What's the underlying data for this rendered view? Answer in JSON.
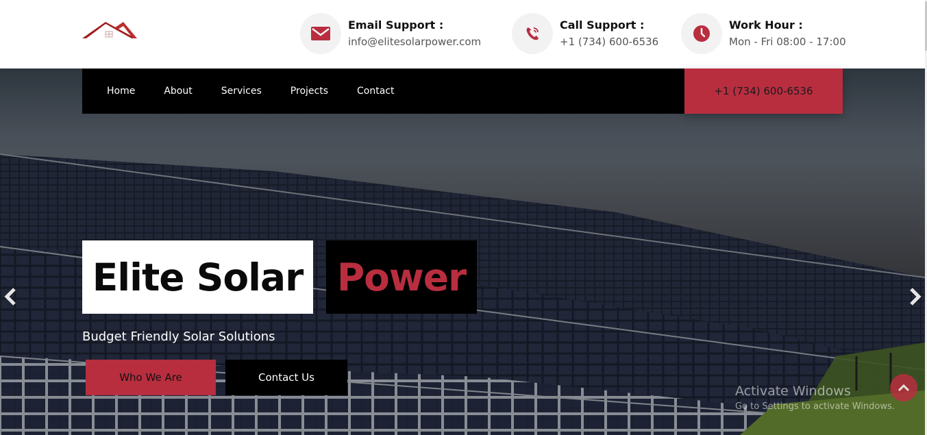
{
  "header": {
    "email_label": "Email Support :",
    "email_value": "info@elitesolarpower.com",
    "call_label": "Call Support :",
    "call_value": "+1 (734) 600-6536",
    "hour_label": "Work Hour :",
    "hour_value": "Mon - Fri 08:00 - 17:00"
  },
  "nav": {
    "items": [
      "Home",
      "About",
      "Services",
      "Projects",
      "Contact"
    ],
    "phone": "+1 (734) 600-6536"
  },
  "hero": {
    "title_part1": "Elite Solar",
    "title_part2": "Power",
    "subtitle": "Budget Friendly Solar Solutions",
    "btn_primary": "Who We Are",
    "btn_secondary": "Contact Us"
  },
  "watermark": {
    "line1": "Activate Windows",
    "line2": "Go to Settings to activate Windows."
  },
  "colors": {
    "accent": "#b82e3f",
    "nav_bg": "#000000",
    "icon_circle": "#f2f2f2"
  },
  "icons": [
    "house-logo-icon",
    "envelope-icon",
    "phone-icon",
    "clock-icon",
    "chevron-left-icon",
    "chevron-right-icon",
    "chevron-up-icon"
  ]
}
